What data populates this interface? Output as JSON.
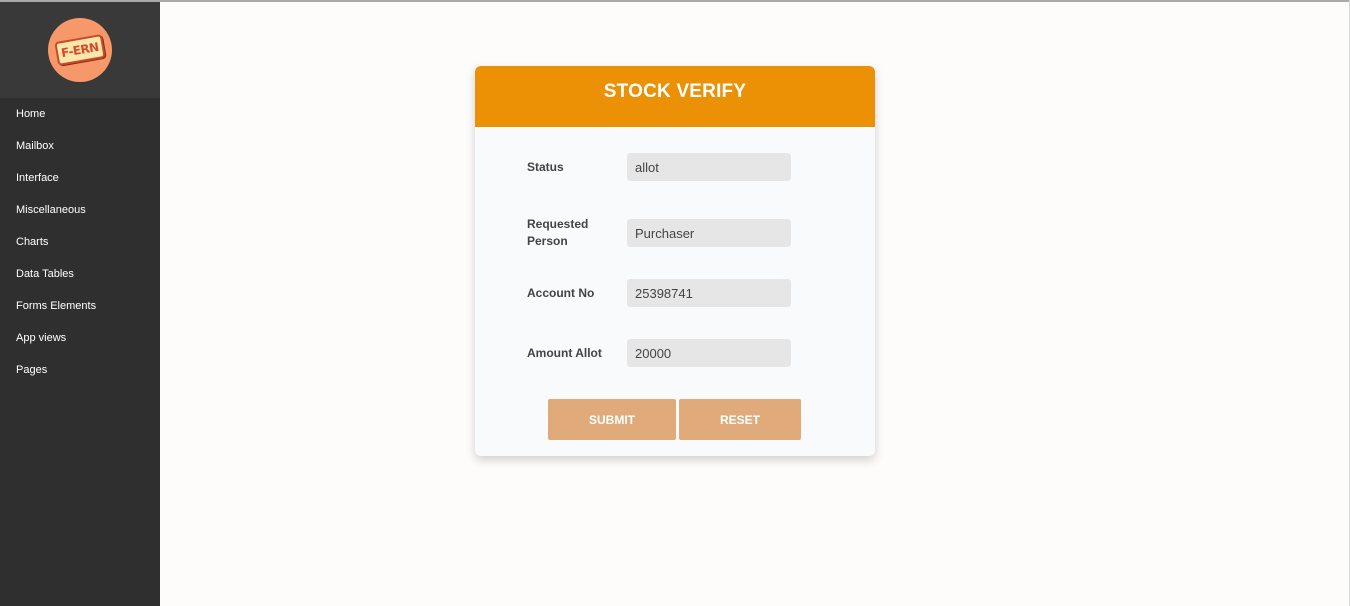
{
  "sidebar": {
    "logo_text": "F-ERN",
    "items": [
      {
        "label": "Home"
      },
      {
        "label": "Mailbox"
      },
      {
        "label": "Interface"
      },
      {
        "label": "Miscellaneous"
      },
      {
        "label": "Charts"
      },
      {
        "label": "Data Tables"
      },
      {
        "label": "Forms Elements"
      },
      {
        "label": "App views"
      },
      {
        "label": "Pages"
      }
    ]
  },
  "form": {
    "title": "STOCK VERIFY",
    "fields": [
      {
        "label": "Status",
        "value": "allot"
      },
      {
        "label": "Requested Person",
        "value": "Purchaser"
      },
      {
        "label": "Account No",
        "value": "25398741"
      },
      {
        "label": "Amount Allot",
        "value": "20000"
      }
    ],
    "submit_label": "SUBMIT",
    "reset_label": "RESET"
  },
  "colors": {
    "header_accent": "#ec9105",
    "button": "#e1aa7a",
    "sidebar_bg": "#2f2f2f",
    "logo_circle": "#f7986a"
  }
}
